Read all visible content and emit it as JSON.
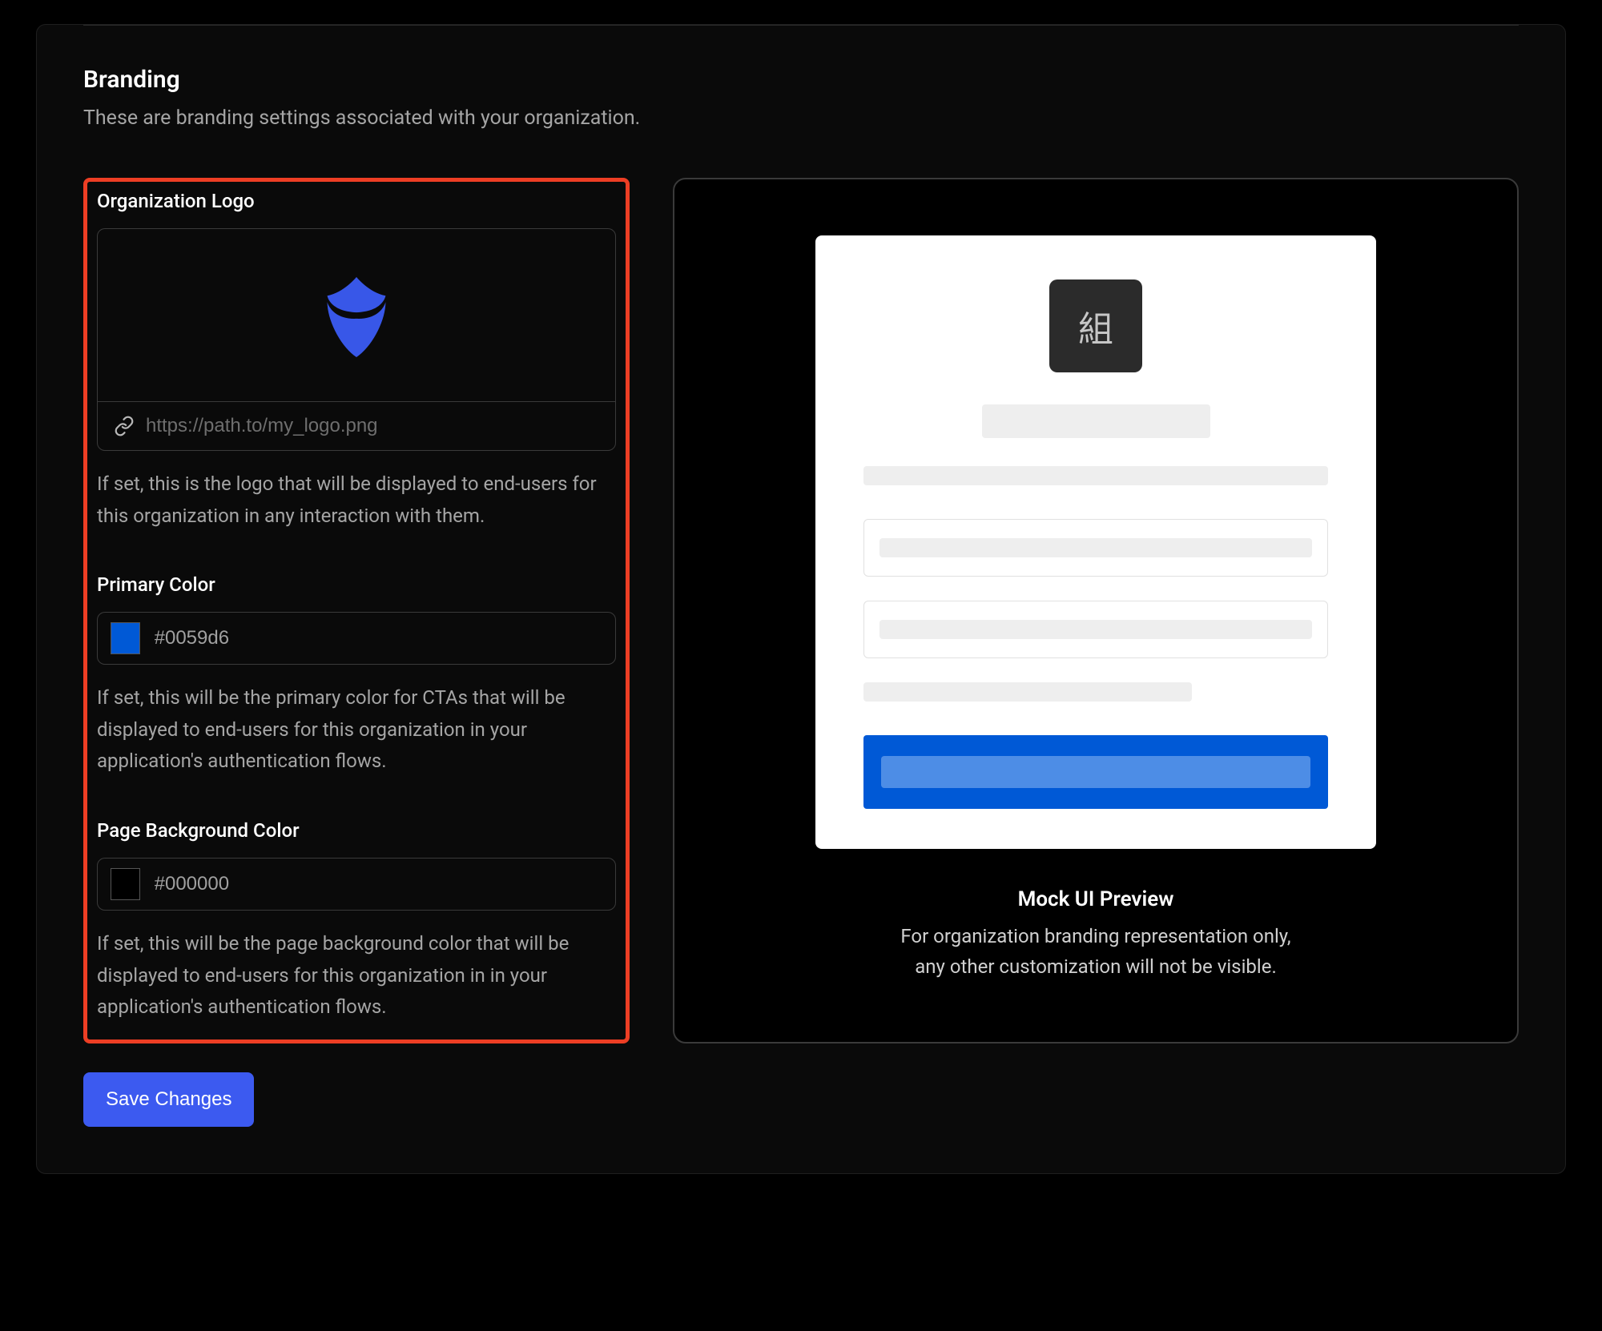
{
  "section": {
    "title": "Branding",
    "description": "These are branding settings associated with your organization."
  },
  "logo": {
    "label": "Organization Logo",
    "placeholder": "https://path.to/my_logo.png",
    "help": "If set, this is the logo that will be displayed to end-users for this organization in any interaction with them."
  },
  "primary_color": {
    "label": "Primary Color",
    "value": "#0059d6",
    "swatch": "#0059d6",
    "help": "If set, this will be the primary color for CTAs that will be displayed to end-users for this organization in your application's authentication flows."
  },
  "bg_color": {
    "label": "Page Background Color",
    "value": "#000000",
    "swatch": "#000000",
    "help": "If set, this will be the page background color that will be displayed to end-users for this organization in in your application's authentication flows."
  },
  "save_label": "Save Changes",
  "preview": {
    "glyph": "組",
    "title": "Mock UI Preview",
    "line1": "For organization branding representation only,",
    "line2": "any other customization will not be visible.",
    "btn_color": "#0059d6",
    "btn_inner": "#4d8de6"
  }
}
